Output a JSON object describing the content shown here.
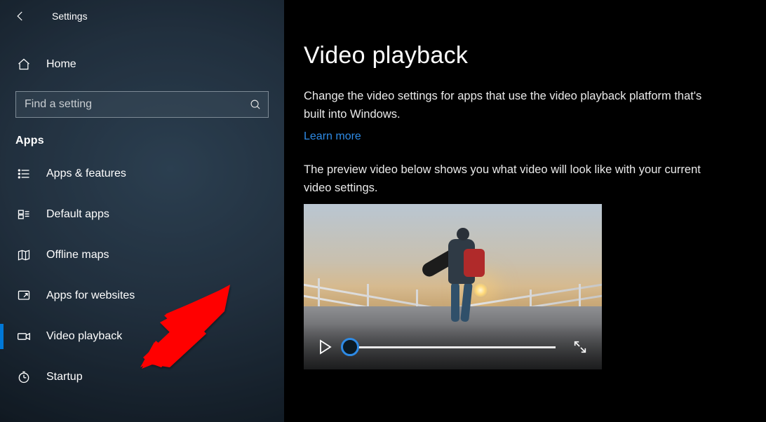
{
  "window": {
    "title": "Settings"
  },
  "sidebar": {
    "home_label": "Home",
    "search_placeholder": "Find a setting",
    "section_label": "Apps",
    "items": [
      {
        "id": "apps-features",
        "label": "Apps & features",
        "icon": "list-icon"
      },
      {
        "id": "default-apps",
        "label": "Default apps",
        "icon": "defaults-icon"
      },
      {
        "id": "offline-maps",
        "label": "Offline maps",
        "icon": "map-icon"
      },
      {
        "id": "apps-websites",
        "label": "Apps for websites",
        "icon": "link-icon"
      },
      {
        "id": "video-playback",
        "label": "Video playback",
        "icon": "video-icon",
        "active": true
      },
      {
        "id": "startup",
        "label": "Startup",
        "icon": "startup-icon"
      }
    ]
  },
  "main": {
    "title": "Video playback",
    "description": "Change the video settings for apps that use the video playback platform that's built into Windows.",
    "learn_more_label": "Learn more",
    "preview_caption": "The preview video below shows you what video will look like with your current video settings."
  },
  "colors": {
    "accent": "#0078d7",
    "link": "#2e8be6"
  },
  "annotation": {
    "type": "arrow",
    "target": "sidebar-item-video-playback",
    "color": "#ff0000"
  }
}
